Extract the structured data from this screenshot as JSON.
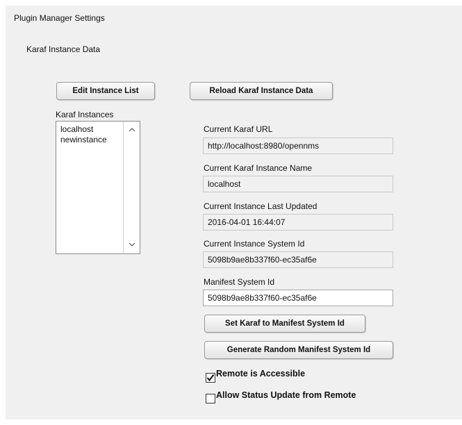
{
  "header": {
    "title": "Plugin Manager Settings",
    "section_title": "Karaf Instance Data"
  },
  "buttons": {
    "edit_instance_list": "Edit Instance List",
    "reload_instance_data": "Reload Karaf Instance Data",
    "set_karaf_to_manifest": "Set Karaf to Manifest System Id",
    "generate_random_manifest": "Generate Random Manifest System Id"
  },
  "instances": {
    "label": "Karaf Instances",
    "items": [
      "localhost",
      "newinstance"
    ]
  },
  "fields": {
    "karaf_url": {
      "label": "Current Karaf URL",
      "value": "http://localhost:8980/opennms"
    },
    "instance_name": {
      "label": "Current Karaf Instance Name",
      "value": "localhost"
    },
    "last_updated": {
      "label": "Current Instance Last Updated",
      "value": "2016-04-01 16:44:07"
    },
    "system_id": {
      "label": "Current Instance System Id",
      "value": "5098b9ae8b337f60-ec35af6e"
    },
    "manifest_system_id": {
      "label": "Manifest System Id",
      "value": "5098b9ae8b337f60-ec35af6e"
    }
  },
  "checkboxes": {
    "remote_accessible": {
      "label": "Remote is Accessible",
      "checked": true
    },
    "allow_status_update": {
      "label": "Allow Status Update from Remote",
      "checked": false
    }
  }
}
